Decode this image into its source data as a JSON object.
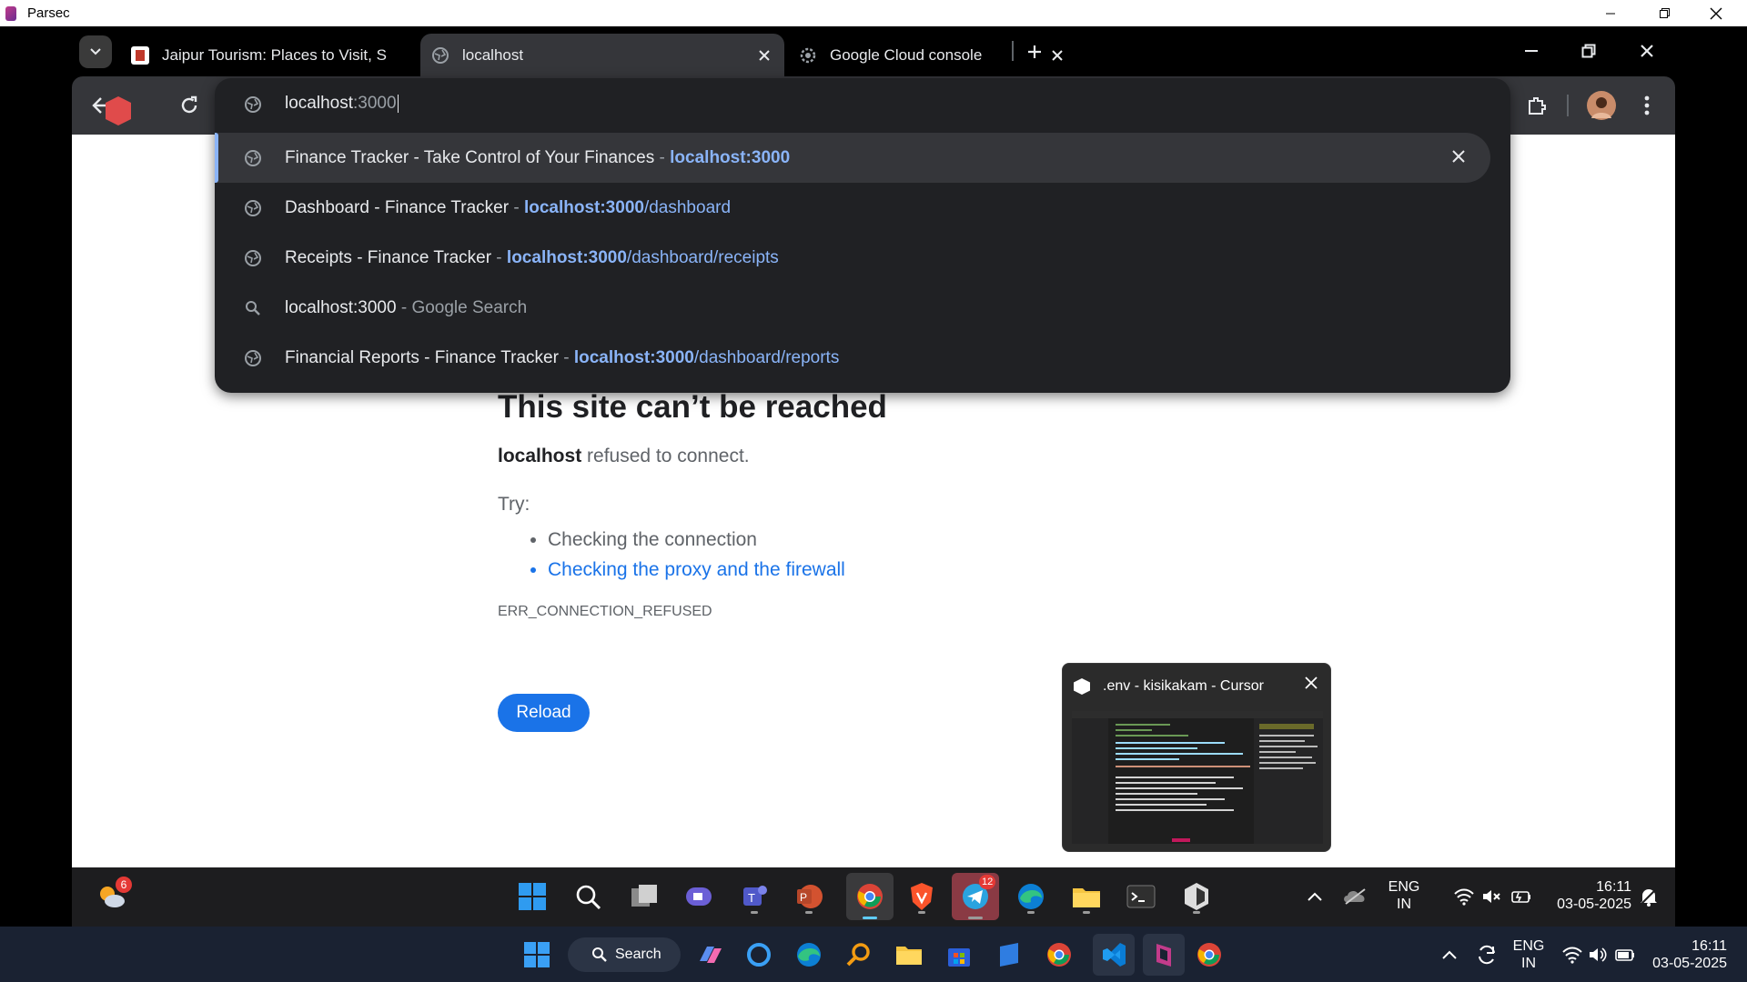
{
  "parsec": {
    "title": "Parsec"
  },
  "browser": {
    "tabs": [
      {
        "title": "Jaipur Tourism: Places to Visit, S",
        "favicon": "page-icon",
        "active": false
      },
      {
        "title": "localhost",
        "favicon": "globe-icon",
        "active": true
      },
      {
        "title": "Google Cloud console",
        "favicon": "cloud-gear-icon",
        "active": false
      }
    ],
    "omnibox": {
      "typed": "localhost",
      "autocomplete": ":3000",
      "suggestions": [
        {
          "title": "Finance Tracker - Take Control of Your Finances",
          "sep": " - ",
          "url_bold": "localhost:3000",
          "url_rest": "",
          "icon": "globe-icon",
          "selected": true
        },
        {
          "title": "Dashboard - Finance Tracker",
          "sep": " - ",
          "url_bold": "localhost:3000",
          "url_rest": "/dashboard",
          "icon": "globe-icon"
        },
        {
          "title": "Receipts - Finance Tracker",
          "sep": " - ",
          "url_bold": "localhost:3000",
          "url_rest": "/dashboard/receipts",
          "icon": "globe-icon"
        },
        {
          "title": "localhost:3000",
          "sep": " - ",
          "url_bold": "",
          "url_rest": "",
          "muted": "Google Search",
          "icon": "search-icon"
        },
        {
          "title": "Financial Reports - Finance Tracker",
          "sep": " - ",
          "url_bold": "localhost:3000",
          "url_rest": "/dashboard/reports",
          "icon": "globe-icon"
        }
      ]
    }
  },
  "error_page": {
    "title": "This site can’t be reached",
    "host": "localhost",
    "desc": " refused to connect.",
    "try": "Try:",
    "suggestions": [
      "Checking the connection",
      "Checking the proxy and the firewall"
    ],
    "code": "ERR_CONNECTION_REFUSED",
    "reload": "Reload"
  },
  "preview": {
    "title": ".env - kisikakam - Cursor"
  },
  "inner_taskbar": {
    "weather_badge": "6",
    "telegram_badge": "12",
    "lang": "ENG",
    "region": "IN",
    "time": "16:11",
    "date": "03-05-2025"
  },
  "host_taskbar": {
    "search": "Search",
    "lang": "ENG",
    "region": "IN",
    "time": "16:11",
    "date": "03-05-2025"
  },
  "colors": {
    "accent": "#1a73e8",
    "omnibox_bg": "#202124",
    "chrome_bg": "#35363a"
  }
}
